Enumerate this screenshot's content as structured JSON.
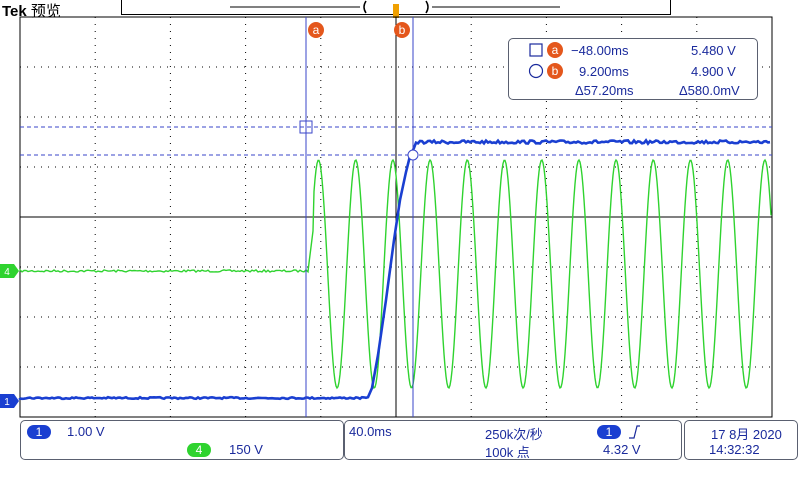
{
  "header": {
    "brand": "Tek",
    "mode": "预览"
  },
  "cursors": {
    "a_label": "a",
    "b_label": "b",
    "trigger_marker": "T"
  },
  "readout": {
    "a_time": "−48.00ms",
    "a_volt": "5.480 V",
    "b_time": "9.200ms",
    "b_volt": "4.900 V",
    "delta_time": "Δ57.20ms",
    "delta_volt": "Δ580.0mV"
  },
  "channels": {
    "ch1": {
      "number": "1",
      "scale": "1.00 V",
      "color": "#1a3fd1"
    },
    "ch4": {
      "number": "4",
      "scale": "150 V",
      "color": "#2fd32f"
    }
  },
  "timebase": {
    "scale": "40.0ms",
    "sample_rate": "250k次/秒",
    "record_length": "100k 点",
    "trigger_source": "1",
    "trigger_level": "4.32 V"
  },
  "datetime": {
    "date": "17 8月 2020",
    "time": "14:32:32"
  },
  "colors": {
    "grid": "#000000",
    "cursor": "#3a46c9",
    "badge_orange": "#e4571c",
    "trigger_orange": "#f0a000"
  }
}
